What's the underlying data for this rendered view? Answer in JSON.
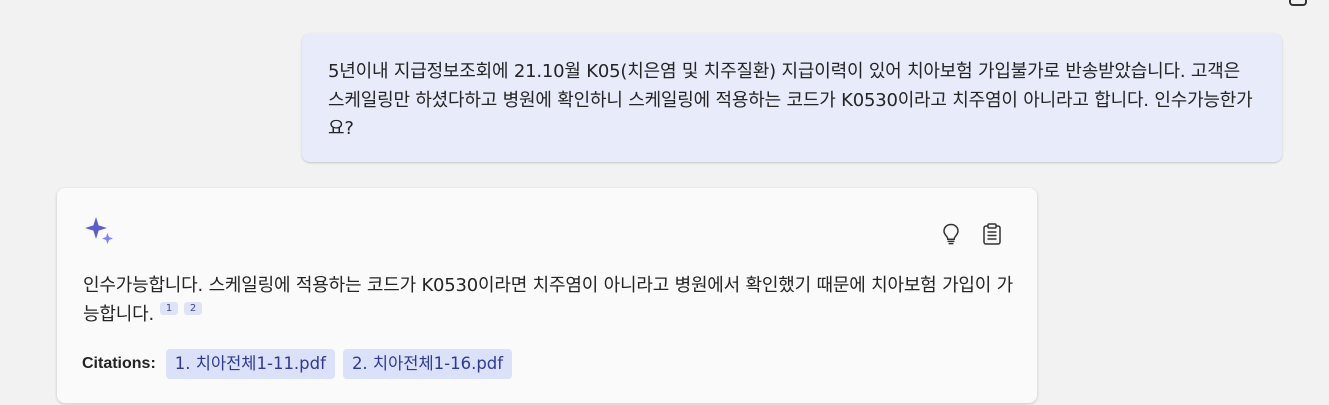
{
  "user_message": {
    "text": "5년이내 지급정보조회에 21.10월 K05(치은염 및 치주질환) 지급이력이 있어 치아보험 가입불가로 반송받았습니다. 고객은 스케일링만 하셨다하고 병원에 확인하니 스케일링에 적용하는 코드가 K0530이라고 치주염이 아니라고 합니다. 인수가능한가요?"
  },
  "bot_message": {
    "icon": "sparkle-icon",
    "actions": {
      "bulb_icon": "lightbulb-icon",
      "copy_icon": "clipboard-icon"
    },
    "text": "인수가능합니다. 스케일링에 적용하는 코드가 K0530이라면 치주염이 아니라고 병원에서 확인했기 때문에 치아보험 가입이 가능합니다.",
    "references": [
      "1",
      "2"
    ],
    "citations_label": "Citations:",
    "citations": [
      "1. 치아전체1-11.pdf",
      "2. 치아전체1-16.pdf"
    ],
    "accent_color": "#5b5fc7"
  }
}
